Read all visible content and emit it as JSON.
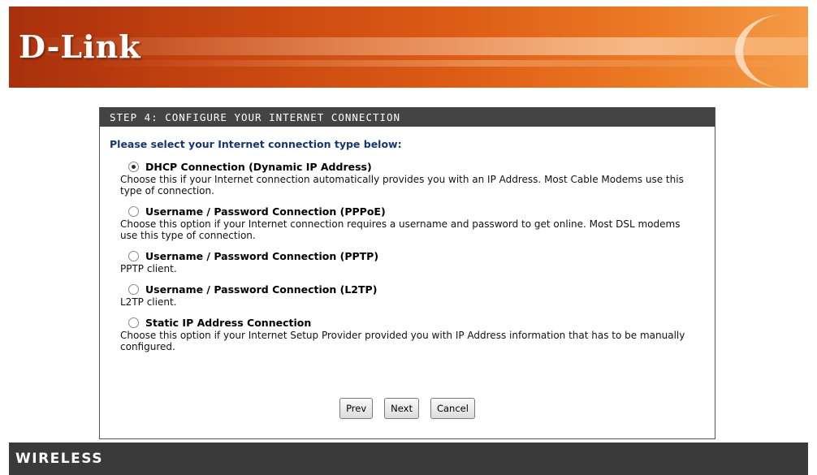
{
  "header": {
    "logo": "D-Link"
  },
  "panel": {
    "title": "STEP 4: CONFIGURE YOUR INTERNET CONNECTION",
    "prompt": "Please select your Internet connection type below:",
    "options": [
      {
        "label": "DHCP Connection (Dynamic IP Address)",
        "description": "Choose this if your Internet connection automatically provides you with an IP Address. Most Cable Modems use this type of connection.",
        "selected": true
      },
      {
        "label": "Username / Password Connection (PPPoE)",
        "description": "Choose this option if your Internet connection requires a username and password to get online. Most DSL modems use this type of connection.",
        "selected": false
      },
      {
        "label": "Username / Password Connection (PPTP)",
        "description": "PPTP client.",
        "selected": false
      },
      {
        "label": "Username / Password Connection (L2TP)",
        "description": "L2TP client.",
        "selected": false
      },
      {
        "label": "Static IP Address Connection",
        "description": "Choose this option if your Internet Setup Provider provided you with IP Address information that has to be manually configured.",
        "selected": false
      }
    ],
    "buttons": {
      "prev": "Prev",
      "next": "Next",
      "cancel": "Cancel"
    }
  },
  "footer": {
    "label": "WIRELESS"
  }
}
